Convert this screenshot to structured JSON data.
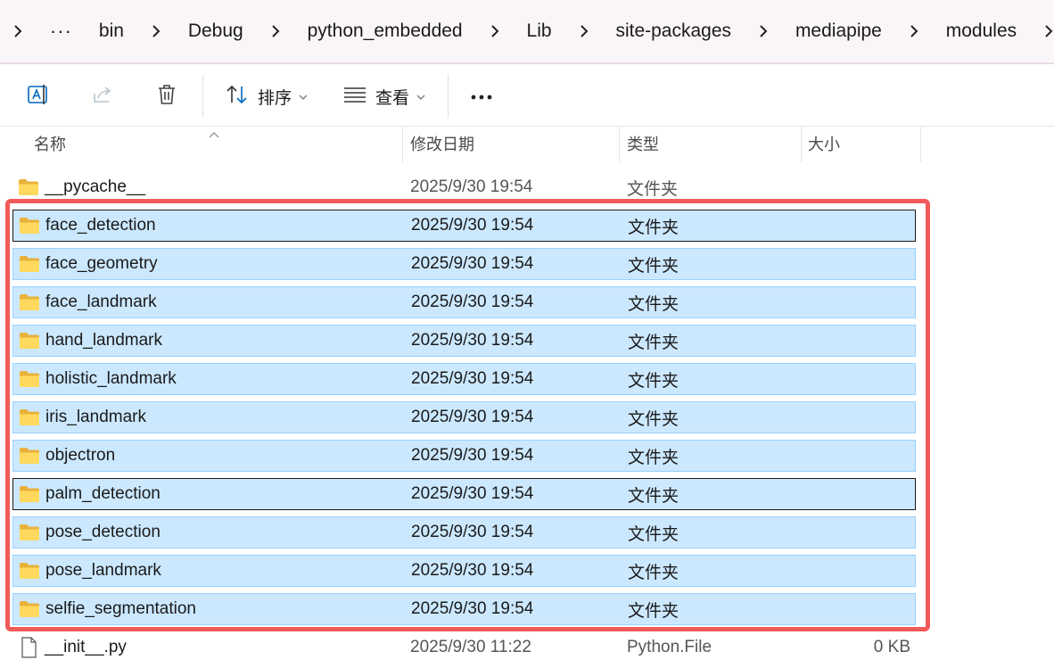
{
  "breadcrumb": {
    "ellipsis": "···",
    "items": [
      "bin",
      "Debug",
      "python_embedded",
      "Lib",
      "site-packages",
      "mediapipe",
      "modules"
    ]
  },
  "toolbar": {
    "rename_icon": "rename-icon",
    "share_icon": "share-icon",
    "delete_icon": "trash-icon",
    "sort_label": "排序",
    "view_label": "查看",
    "more_label": "···"
  },
  "columns": {
    "name": "名称",
    "date": "修改日期",
    "type": "类型",
    "size": "大小"
  },
  "files": [
    {
      "name": "__pycache__",
      "date": "2025/9/30 19:54",
      "type": "文件夹",
      "size": "",
      "icon": "folder-icon",
      "selected": false
    },
    {
      "name": "face_detection",
      "date": "2025/9/30 19:54",
      "type": "文件夹",
      "size": "",
      "icon": "folder-icon",
      "selected": true
    },
    {
      "name": "face_geometry",
      "date": "2025/9/30 19:54",
      "type": "文件夹",
      "size": "",
      "icon": "folder-icon",
      "selected": true
    },
    {
      "name": "face_landmark",
      "date": "2025/9/30 19:54",
      "type": "文件夹",
      "size": "",
      "icon": "folder-icon",
      "selected": true
    },
    {
      "name": "hand_landmark",
      "date": "2025/9/30 19:54",
      "type": "文件夹",
      "size": "",
      "icon": "folder-icon",
      "selected": true
    },
    {
      "name": "holistic_landmark",
      "date": "2025/9/30 19:54",
      "type": "文件夹",
      "size": "",
      "icon": "folder-icon",
      "selected": true
    },
    {
      "name": "iris_landmark",
      "date": "2025/9/30 19:54",
      "type": "文件夹",
      "size": "",
      "icon": "folder-icon",
      "selected": true
    },
    {
      "name": "objectron",
      "date": "2025/9/30 19:54",
      "type": "文件夹",
      "size": "",
      "icon": "folder-icon",
      "selected": true
    },
    {
      "name": "palm_detection",
      "date": "2025/9/30 19:54",
      "type": "文件夹",
      "size": "",
      "icon": "folder-icon",
      "selected": true
    },
    {
      "name": "pose_detection",
      "date": "2025/9/30 19:54",
      "type": "文件夹",
      "size": "",
      "icon": "folder-icon",
      "selected": true
    },
    {
      "name": "pose_landmark",
      "date": "2025/9/30 19:54",
      "type": "文件夹",
      "size": "",
      "icon": "folder-icon",
      "selected": true
    },
    {
      "name": "selfie_segmentation",
      "date": "2025/9/30 19:54",
      "type": "文件夹",
      "size": "",
      "icon": "folder-icon",
      "selected": true
    },
    {
      "name": "__init__.py",
      "date": "2025/9/30 11:22",
      "type": "Python.File",
      "size": "0 KB",
      "icon": "python-file-icon",
      "selected": false
    }
  ],
  "colors": {
    "selection_bg": "#cce8ff",
    "selection_border": "#99d1ff",
    "highlight_border": "#f25a5a",
    "folder_yellow": "#f8d775"
  }
}
